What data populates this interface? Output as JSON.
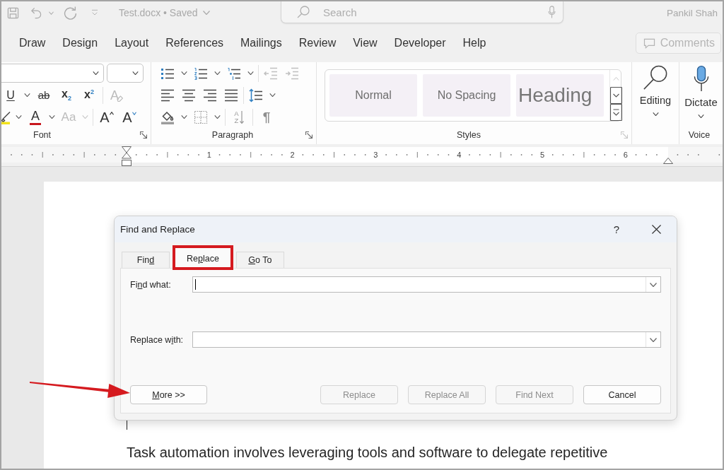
{
  "title_bar": {
    "quick_access": [
      {
        "kind": "save",
        "dropdown": false
      },
      {
        "kind": "undo",
        "dropdown": true
      },
      {
        "kind": "redo",
        "dropdown": false
      },
      {
        "kind": "customize",
        "dropdown": false
      }
    ],
    "document_title": "Test.docx • Saved",
    "search": {
      "placeholder": "Search"
    },
    "user_name": "Pankil Shah"
  },
  "ribbon_tabs": [
    {
      "label": "Draw",
      "selected": false
    },
    {
      "label": "Design",
      "selected": false
    },
    {
      "label": "Layout",
      "selected": false
    },
    {
      "label": "References",
      "selected": false
    },
    {
      "label": "Mailings",
      "selected": false
    },
    {
      "label": "Review",
      "selected": false
    },
    {
      "label": "View",
      "selected": false
    },
    {
      "label": "Developer",
      "selected": false
    },
    {
      "label": "Help",
      "selected": false
    }
  ],
  "comments_button": {
    "label": "Comments",
    "disabled": true
  },
  "ribbon": {
    "groups": [
      {
        "kind": "tools",
        "label": "Font",
        "launcher": {
          "disabled": false
        },
        "fields": [
          {
            "kind": "font-name"
          },
          {
            "kind": "font-size"
          }
        ],
        "rows": [
          [
            [
              {
                "kind": "underline",
                "glyph": "U",
                "dropdown": true,
                "disabled": false
              },
              {
                "kind": "strikethrough",
                "glyph": "ab",
                "dropdown": false,
                "disabled": false
              },
              {
                "kind": "subscript",
                "glyph": "x$_{2}$",
                "dropdown": false,
                "disabled": false
              },
              {
                "kind": "superscript",
                "glyph": "x$^{2}$",
                "dropdown": false,
                "disabled": false
              }
            ],
            [
              {
                "kind": "clear-formatting",
                "glyph": "A",
                "dropdown": false,
                "disabled": true
              }
            ]
          ],
          [
            [
              {
                "kind": "highlight",
                "dropdown": true,
                "disabled": false
              },
              {
                "kind": "font-color",
                "glyph": "A",
                "dropdown": true,
                "disabled": false
              },
              {
                "kind": "change-case",
                "glyph": "Aa",
                "dropdown": true,
                "disabled": true
              }
            ],
            [
              {
                "kind": "grow-font",
                "glyph": "A",
                "dropdown": false,
                "disabled": false
              },
              {
                "kind": "shrink-font",
                "glyph": "A",
                "dropdown": false,
                "disabled": false
              }
            ]
          ]
        ]
      },
      {
        "kind": "tools",
        "label": "Paragraph",
        "launcher": {
          "disabled": false
        },
        "rows": [
          [
            [
              {
                "kind": "bullets",
                "dropdown": true,
                "disabled": false
              },
              {
                "kind": "numbering",
                "dropdown": true,
                "disabled": false
              },
              {
                "kind": "multilevel",
                "dropdown": true,
                "disabled": false
              }
            ],
            [
              {
                "kind": "decrease-indent",
                "dropdown": false,
                "disabled": true
              },
              {
                "kind": "increase-indent",
                "dropdown": false,
                "disabled": true
              }
            ]
          ],
          [
            [
              {
                "kind": "align-left",
                "dropdown": false,
                "disabled": false
              },
              {
                "kind": "align-center",
                "dropdown": false,
                "disabled": false
              },
              {
                "kind": "align-right",
                "dropdown": false,
                "disabled": false
              },
              {
                "kind": "justify",
                "dropdown": false,
                "disabled": false
              }
            ],
            [
              {
                "kind": "line-spacing",
                "dropdown": true,
                "disabled": false
              }
            ]
          ],
          [
            [
              {
                "kind": "shading",
                "dropdown": true,
                "disabled": false
              },
              {
                "kind": "borders",
                "dropdown": true,
                "disabled": false
              }
            ],
            [
              {
                "kind": "sort",
                "glyph": "AZ",
                "dropdown": false,
                "disabled": false
              }
            ],
            [
              {
                "kind": "show-marks",
                "glyph": "¶",
                "dropdown": false,
                "disabled": false
              }
            ]
          ]
        ]
      },
      {
        "kind": "styles",
        "label": "Styles",
        "launcher": {
          "disabled": true
        },
        "scroll_up_disabled": true,
        "items": [
          {
            "label": "Normal",
            "kind": "body"
          },
          {
            "label": "No Spacing",
            "kind": "body"
          },
          {
            "label": "Heading",
            "kind": "heading"
          }
        ]
      },
      {
        "kind": "editing",
        "button": "Editing"
      },
      {
        "kind": "voice",
        "button": "Dictate",
        "label": "Voice"
      }
    ]
  },
  "ruler": {
    "labels": [
      "1",
      "2",
      "3",
      "4",
      "5",
      "6"
    ]
  },
  "document": {
    "caret": true,
    "paragraph": "Task automation involves leveraging tools and software to delegate repetitive"
  },
  "dialog": {
    "title": "Find and Replace",
    "help": "?",
    "tabs": [
      {
        "label": {
          "start": "Fin",
          "key": "d"
        },
        "selected": false,
        "highlighted": false
      },
      {
        "label": {
          "start": "Re",
          "key": "p",
          "end": "lace"
        },
        "selected": true,
        "highlighted": true
      },
      {
        "label": {
          "key": "G",
          "end": "o To"
        },
        "selected": false,
        "highlighted": false
      }
    ],
    "fields": [
      {
        "label": {
          "start": "Fi",
          "key": "n",
          "end": "d what:"
        },
        "focused": true
      },
      {
        "label": {
          "start": "Replace w",
          "key": "i",
          "end": "th:"
        },
        "focused": false
      }
    ],
    "buttons": [
      {
        "label": {
          "key": "M",
          "end": "ore >>"
        },
        "disabled": false,
        "pointed_at": true
      },
      {
        "label": {
          "start": "Replace"
        },
        "disabled": true,
        "pointed_at": false
      },
      {
        "label": {
          "start": "Replace All"
        },
        "disabled": true,
        "pointed_at": false
      },
      {
        "label": {
          "start": "Find Next"
        },
        "disabled": true,
        "pointed_at": false
      },
      {
        "label": {
          "start": "Cancel"
        },
        "disabled": false,
        "pointed_at": false
      }
    ]
  }
}
